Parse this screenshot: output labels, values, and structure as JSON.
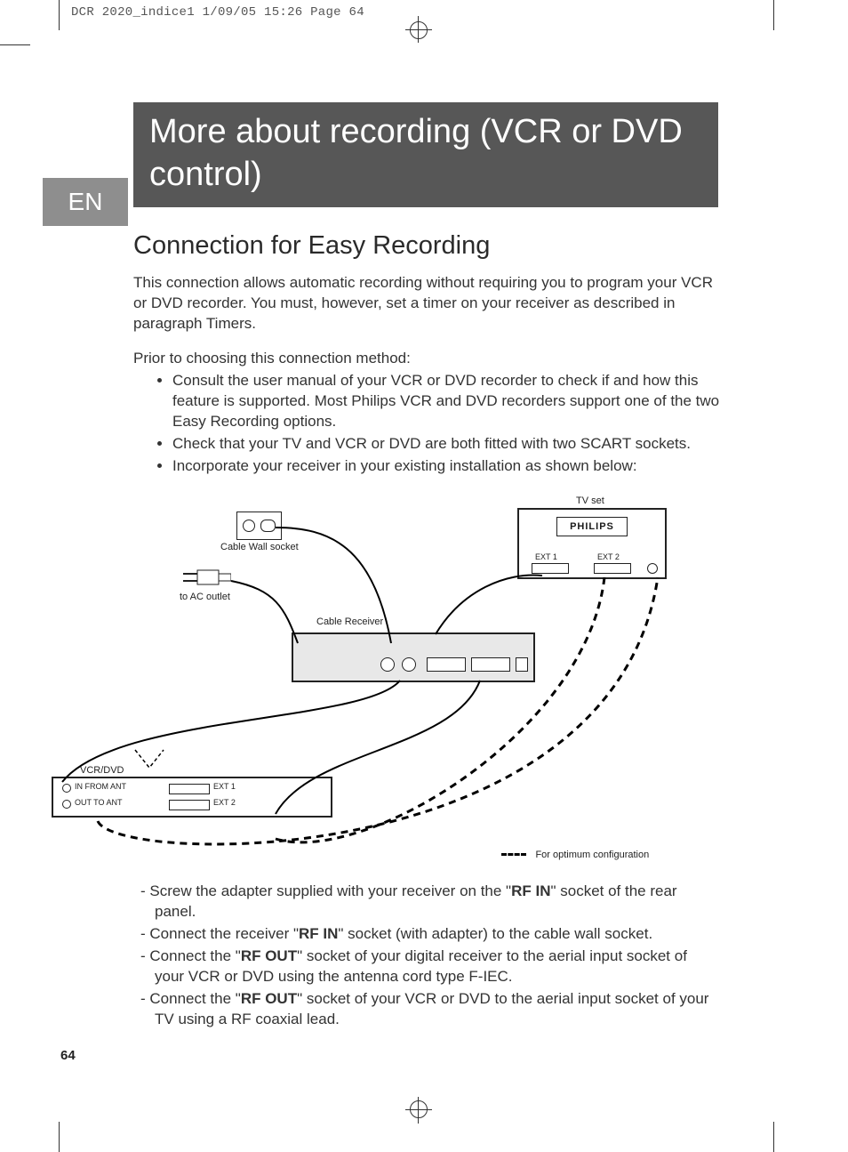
{
  "slugline": "DCR 2020_indice1  1/09/05  15:26  Page 64",
  "lang_tab": "EN",
  "title_box": "More about recording (VCR or DVD control)",
  "h2": "Connection for Easy Recording",
  "p1": "This connection allows automatic recording without requiring you to program your VCR or DVD recorder. You must, however, set a timer on your receiver as described in paragraph Timers.",
  "p2": "Prior to choosing this connection method:",
  "bullets": [
    "Consult the user manual of your VCR or DVD recorder to check if and how this feature is supported. Most Philips VCR and DVD recorders support one of the two Easy Recording options.",
    "Check that your TV and VCR or DVD are both fitted with two SCART sockets.",
    "Incorporate your receiver in your existing installation as shown below:"
  ],
  "diagram": {
    "tv_set": "TV set",
    "cable_wall": "Cable Wall socket",
    "ac_outlet": "to AC outlet",
    "cable_receiver": "Cable Receiver",
    "ext1": "EXT 1",
    "ext2": "EXT 2",
    "vcr_dvd": "VCR/DVD",
    "in_from_ant": "IN FROM ANT",
    "out_to_ant": "OUT TO ANT",
    "optimum": "For optimum configuration",
    "brand": "PHILIPS"
  },
  "steps": [
    {
      "pre": "Screw the adapter supplied with your receiver on the \"",
      "bold": "RF IN",
      "post": "\" socket of the rear panel."
    },
    {
      "pre": "Connect the receiver \"",
      "bold": "RF IN",
      "post": "\" socket (with adapter) to the cable wall socket."
    },
    {
      "pre": "Connect the \"",
      "bold": "RF OUT",
      "post": "\" socket of your digital receiver to the aerial input socket of your VCR or DVD using the antenna cord type F-IEC."
    },
    {
      "pre": "Connect the \"",
      "bold": "RF OUT",
      "post": "\" socket of your VCR or DVD to the aerial input socket of your TV using a RF coaxial lead."
    }
  ],
  "page_number": "64"
}
